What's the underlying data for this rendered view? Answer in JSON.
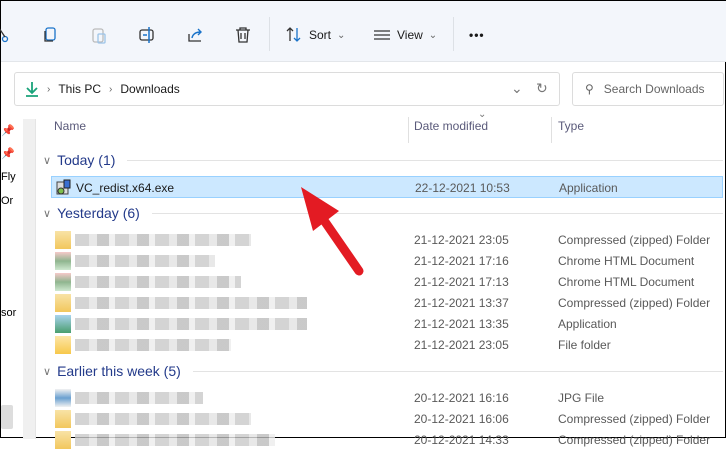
{
  "toolbar": {
    "sort_label": "Sort",
    "view_label": "View",
    "more_label": "•••"
  },
  "address": {
    "crumbs": [
      "This PC",
      "Downloads"
    ]
  },
  "search": {
    "placeholder": "Search Downloads"
  },
  "leftnav": {
    "fragments": [
      "Fly",
      "Or",
      "sor"
    ]
  },
  "columns": {
    "name": "Name",
    "date": "Date modified",
    "type": "Type"
  },
  "groups": [
    {
      "label": "Today (1)",
      "rows": [
        {
          "name": "VC_redist.x64.exe",
          "date": "22-12-2021 10:53",
          "type": "Application"
        }
      ]
    },
    {
      "label": "Yesterday (6)",
      "rows": [
        {
          "date": "21-12-2021 23:05",
          "type": "Compressed (zipped) Folder"
        },
        {
          "date": "21-12-2021 17:16",
          "type": "Chrome HTML Document"
        },
        {
          "date": "21-12-2021 17:13",
          "type": "Chrome HTML Document"
        },
        {
          "date": "21-12-2021 13:37",
          "type": "Compressed (zipped) Folder"
        },
        {
          "date": "21-12-2021 13:35",
          "type": "Application"
        },
        {
          "date": "21-12-2021 23:05",
          "type": "File folder"
        }
      ]
    },
    {
      "label": "Earlier this week (5)",
      "rows": [
        {
          "date": "20-12-2021 16:16",
          "type": "JPG File"
        },
        {
          "date": "20-12-2021 16:06",
          "type": "Compressed (zipped) Folder"
        },
        {
          "date": "20-12-2021 14:33",
          "type": "Compressed (zipped) Folder"
        }
      ]
    }
  ],
  "colors": {
    "accent": "#233a8a",
    "selection": "#cce8ff",
    "arrow": "#e31b23"
  }
}
